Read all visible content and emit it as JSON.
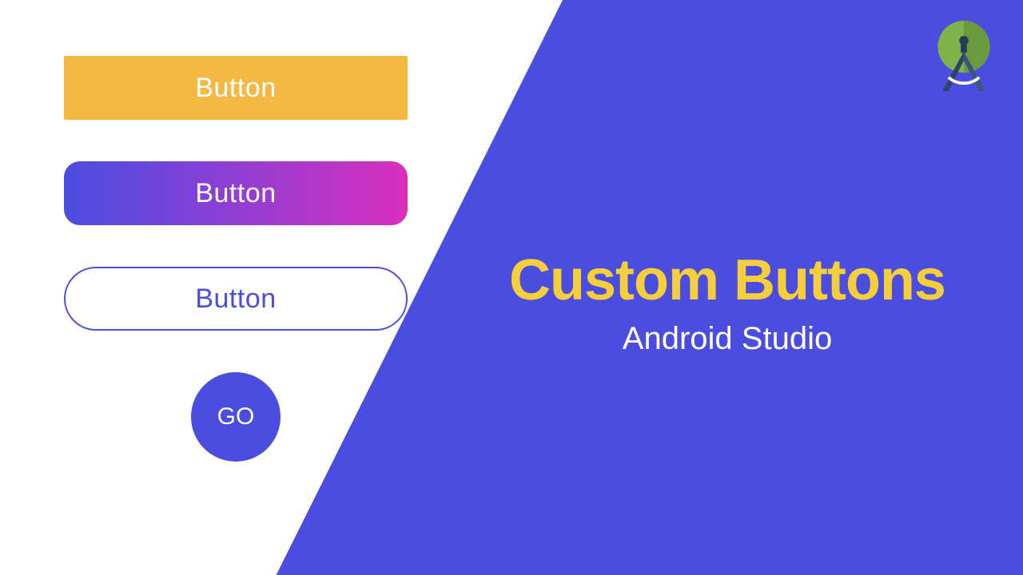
{
  "buttons": {
    "flat": {
      "label": "Button"
    },
    "gradient": {
      "label": "Button"
    },
    "outline": {
      "label": "Button"
    },
    "circle": {
      "label": "GO"
    }
  },
  "hero": {
    "title": "Custom Buttons",
    "subtitle": "Android Studio"
  },
  "colors": {
    "primary": "#4b4de0",
    "accent_yellow": "#f5b941",
    "title_yellow": "#f4cf3a",
    "gradient_start": "#4b4de0",
    "gradient_end": "#d92fbd"
  },
  "logo": {
    "name": "android-studio-logo"
  }
}
